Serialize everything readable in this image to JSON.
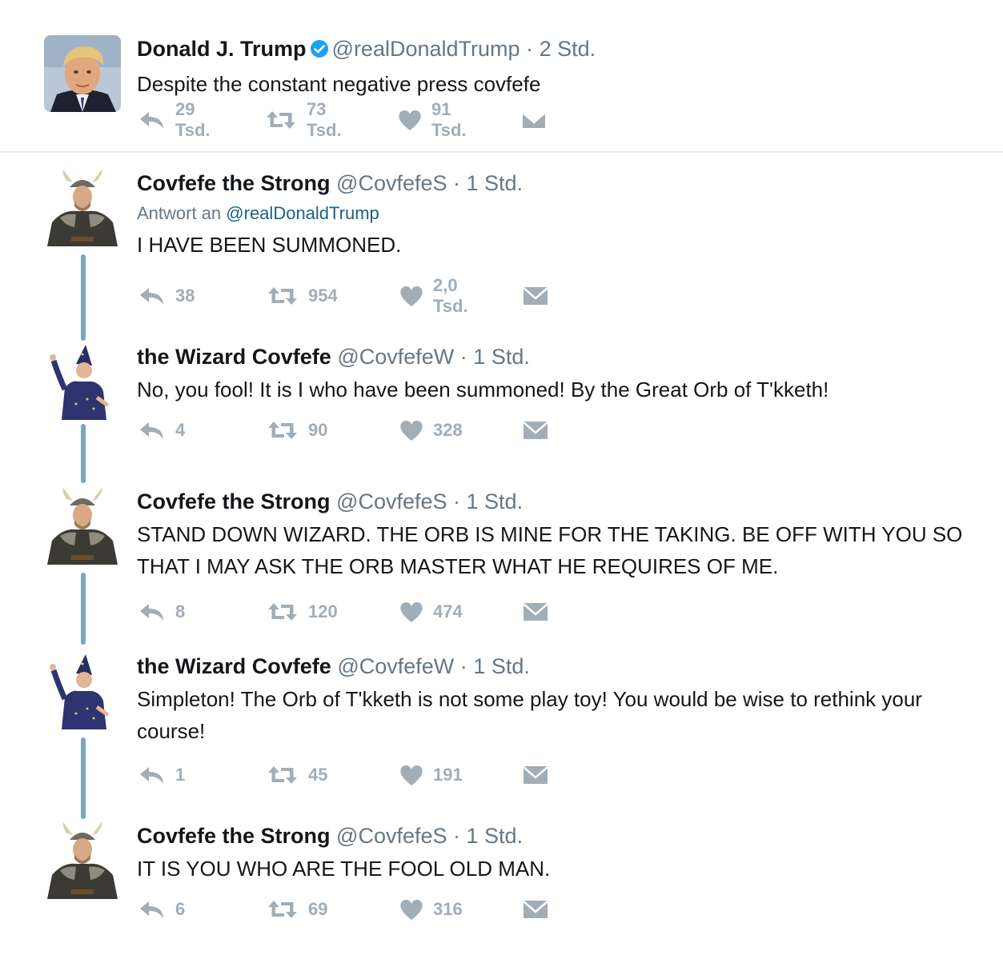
{
  "main_tweet": {
    "name": "Donald J. Trump",
    "handle": "@realDonaldTrump",
    "time": "2 Std.",
    "text": "Despite the constant negative press covfefe",
    "replies": "29 Tsd.",
    "retweets": "73 Tsd.",
    "likes": "91 Tsd."
  },
  "replies": [
    {
      "name": "Covfefe the Strong",
      "handle": "@CovfefeS",
      "time": "1 Std.",
      "reply_prefix": "Antwort an",
      "reply_to": "@realDonaldTrump",
      "text": "I HAVE BEEN SUMMONED.",
      "replies": "38",
      "retweets": "954",
      "likes": "2,0 Tsd."
    },
    {
      "name": "the Wizard Covfefe",
      "handle": "@CovfefeW",
      "time": "1 Std.",
      "text": "No, you fool! It is I who have been summoned! By the Great Orb of T'kketh!",
      "replies": "4",
      "retweets": "90",
      "likes": "328"
    },
    {
      "name": "Covfefe the Strong",
      "handle": "@CovfefeS",
      "time": "1 Std.",
      "text": "STAND DOWN WIZARD. THE ORB IS MINE FOR THE TAKING. BE OFF WITH YOU SO THAT I MAY ASK THE ORB MASTER WHAT HE REQUIRES OF ME.",
      "replies": "8",
      "retweets": "120",
      "likes": "474"
    },
    {
      "name": "the Wizard Covfefe",
      "handle": "@CovfefeW",
      "time": "1 Std.",
      "text": "Simpleton! The Orb of T'kketh is not some play toy! You would be wise to rethink your course!",
      "replies": "1",
      "retweets": "45",
      "likes": "191"
    },
    {
      "name": "Covfefe the Strong",
      "handle": "@CovfefeS",
      "time": "1 Std.",
      "text": "IT IS YOU WHO ARE THE FOOL OLD MAN.",
      "replies": "6",
      "retweets": "69",
      "likes": "316"
    }
  ],
  "separator": "·",
  "icons": {
    "reply": "reply-icon",
    "retweet": "retweet-icon",
    "like": "heart-icon",
    "dm": "envelope-icon",
    "verified": "verified-badge-icon"
  },
  "colors": {
    "text": "#14171a",
    "muted": "#657786",
    "action": "#a1adb7",
    "verified": "#1da1f2",
    "thread": "#79a7ba",
    "link": "#1b6184"
  }
}
